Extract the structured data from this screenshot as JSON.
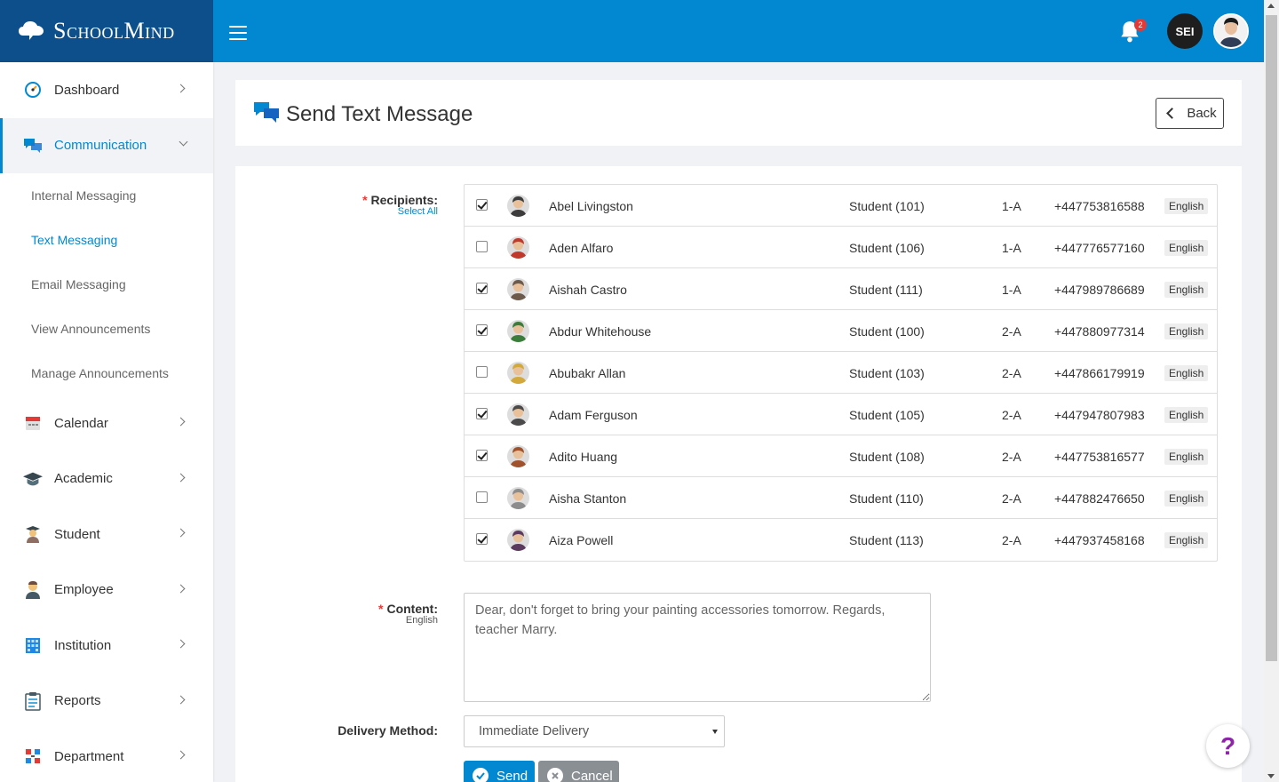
{
  "brand": {
    "name": "SchoolMind"
  },
  "topbar": {
    "notification_count": "2",
    "user_initials": "SEI"
  },
  "sidebar": {
    "items": [
      {
        "label": "Dashboard",
        "icon": "dashboard-gauge-icon"
      },
      {
        "label": "Communication",
        "icon": "chat-bubbles-icon",
        "active": true,
        "sub": [
          {
            "label": "Internal Messaging"
          },
          {
            "label": "Text Messaging",
            "active": true
          },
          {
            "label": "Email Messaging"
          },
          {
            "label": "View Announcements"
          },
          {
            "label": "Manage Announcements"
          }
        ]
      },
      {
        "label": "Calendar",
        "icon": "calendar-icon"
      },
      {
        "label": "Academic",
        "icon": "graduation-cap-icon"
      },
      {
        "label": "Student",
        "icon": "student-icon"
      },
      {
        "label": "Employee",
        "icon": "employee-icon"
      },
      {
        "label": "Institution",
        "icon": "building-icon"
      },
      {
        "label": "Reports",
        "icon": "clipboard-icon"
      },
      {
        "label": "Department",
        "icon": "department-icon"
      }
    ]
  },
  "page": {
    "title": "Send Text Message",
    "back_label": "Back"
  },
  "form": {
    "recipients_label": "Recipients:",
    "select_all_label": "Select All",
    "content_label": "Content:",
    "content_lang": "English",
    "content_value": "Dear, don't forget to bring your painting accessories tomorrow. Regards, teacher Marry.",
    "delivery_label": "Delivery Method:",
    "delivery_value": "Immediate Delivery",
    "send_label": "Send",
    "cancel_label": "Cancel"
  },
  "recipients": [
    {
      "checked": true,
      "name": "Abel Livingston",
      "type": "Student (101)",
      "class": "1-A",
      "phone": "+447753816588",
      "lang": "English",
      "avatar_color": "#3c3c3c"
    },
    {
      "checked": false,
      "name": "Aden Alfaro",
      "type": "Student (106)",
      "class": "1-A",
      "phone": "+447776577160",
      "lang": "English",
      "avatar_color": "#c0392b"
    },
    {
      "checked": true,
      "name": "Aishah Castro",
      "type": "Student (111)",
      "class": "1-A",
      "phone": "+447989786689",
      "lang": "English",
      "avatar_color": "#6d5a4b"
    },
    {
      "checked": true,
      "name": "Abdur Whitehouse",
      "type": "Student (100)",
      "class": "2-A",
      "phone": "+447880977314",
      "lang": "English",
      "avatar_color": "#3a7d3a"
    },
    {
      "checked": false,
      "name": "Abubakr Allan",
      "type": "Student (103)",
      "class": "2-A",
      "phone": "+447866179919",
      "lang": "English",
      "avatar_color": "#d4a93c"
    },
    {
      "checked": true,
      "name": "Adam Ferguson",
      "type": "Student (105)",
      "class": "2-A",
      "phone": "+447947807983",
      "lang": "English",
      "avatar_color": "#4a4a4a"
    },
    {
      "checked": true,
      "name": "Adito Huang",
      "type": "Student (108)",
      "class": "2-A",
      "phone": "+447753816577",
      "lang": "English",
      "avatar_color": "#a0522d"
    },
    {
      "checked": false,
      "name": "Aisha Stanton",
      "type": "Student (110)",
      "class": "2-A",
      "phone": "+447882476650",
      "lang": "English",
      "avatar_color": "#8c8c8c"
    },
    {
      "checked": true,
      "name": "Aiza Powell",
      "type": "Student (113)",
      "class": "2-A",
      "phone": "+447937458168",
      "lang": "English",
      "avatar_color": "#5b3a5e"
    }
  ],
  "help": {
    "label": "?"
  }
}
